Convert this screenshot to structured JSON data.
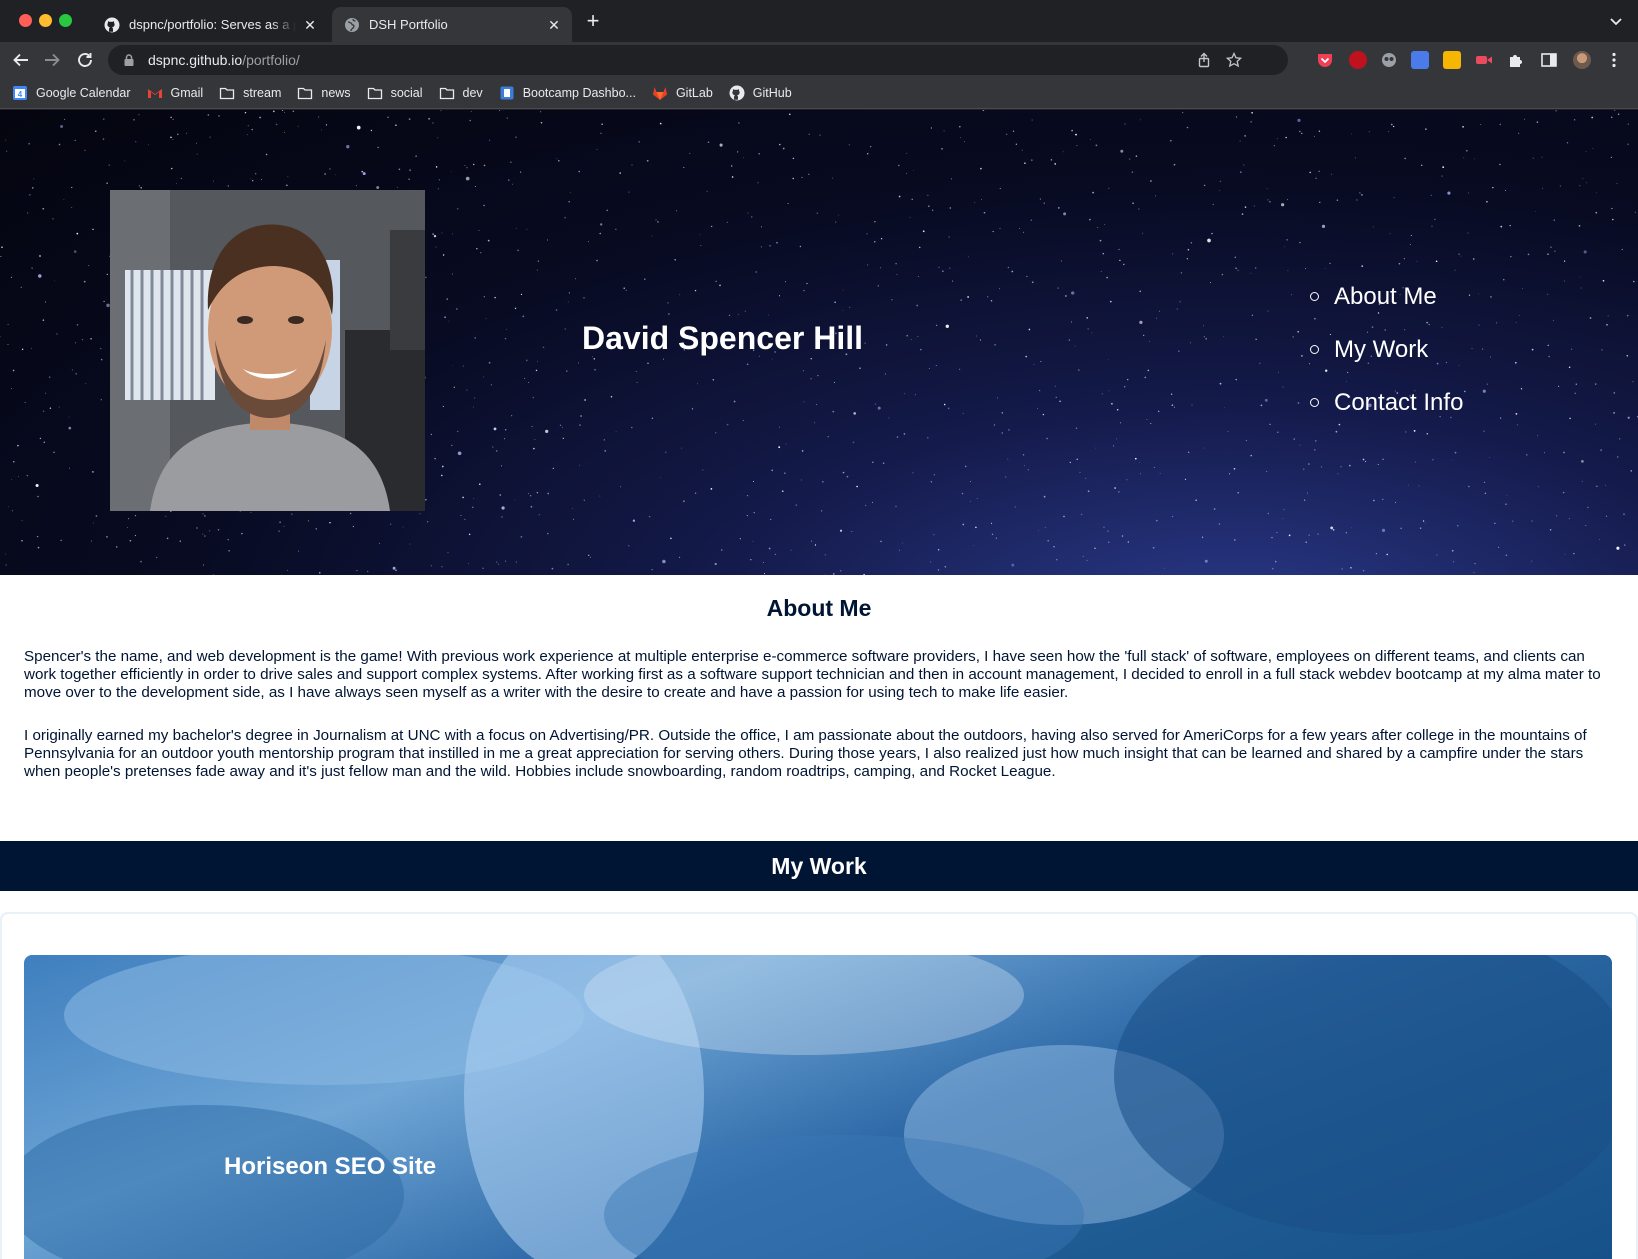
{
  "browser": {
    "tabs": [
      {
        "title": "dspnc/portfolio: Serves as a portfolio"
      },
      {
        "title": "DSH Portfolio"
      }
    ],
    "url_host": "dspnc.github.io",
    "url_path": "/portfolio/",
    "bookmarks": [
      {
        "label": "Google Calendar",
        "icon": "calendar-icon"
      },
      {
        "label": "Gmail",
        "icon": "gmail-icon"
      },
      {
        "label": "stream",
        "icon": "folder-icon"
      },
      {
        "label": "news",
        "icon": "folder-icon"
      },
      {
        "label": "social",
        "icon": "folder-icon"
      },
      {
        "label": "dev",
        "icon": "folder-icon"
      },
      {
        "label": "Bootcamp Dashbo...",
        "icon": "bootcamp-icon"
      },
      {
        "label": "GitLab",
        "icon": "gitlab-icon"
      },
      {
        "label": "GitHub",
        "icon": "github-icon"
      }
    ]
  },
  "page": {
    "hero": {
      "name": "David Spencer Hill",
      "nav": [
        "About Me",
        "My Work",
        "Contact Info"
      ]
    },
    "about": {
      "title": "About Me",
      "p1": "Spencer's the name, and web development is the game! With previous work experience at multiple enterprise e-commerce software providers, I have seen how the 'full stack' of software, employees on different teams, and clients can work together efficiently in order to drive sales and support complex systems. After working first as a software support technician and then in account management, I decided to enroll in a full stack webdev bootcamp at my alma mater to move over to the development side, as I have always seen myself as a writer with the desire to create and have a passion for using tech to make life easier.",
      "p2": "I originally earned my bachelor's degree in Journalism at UNC with a focus on Advertising/PR. Outside the office, I am passionate about the outdoors, having also served for AmeriCorps for a few years after college in the mountains of Pennsylvania for an outdoor youth mentorship program that instilled in me a great appreciation for serving others. During those years, I also realized just how much insight that can be learned and shared by a campfire under the stars when people's pretenses fade away and it's just fellow man and the wild. Hobbies include snowboarding, random roadtrips, camping, and Rocket League."
    },
    "work": {
      "title": "My Work",
      "projects": [
        {
          "title": "Horiseon SEO Site"
        }
      ]
    }
  },
  "colors": {
    "navy": "#001433",
    "chrome_dark": "#202124",
    "chrome_toolbar": "#35363a"
  }
}
